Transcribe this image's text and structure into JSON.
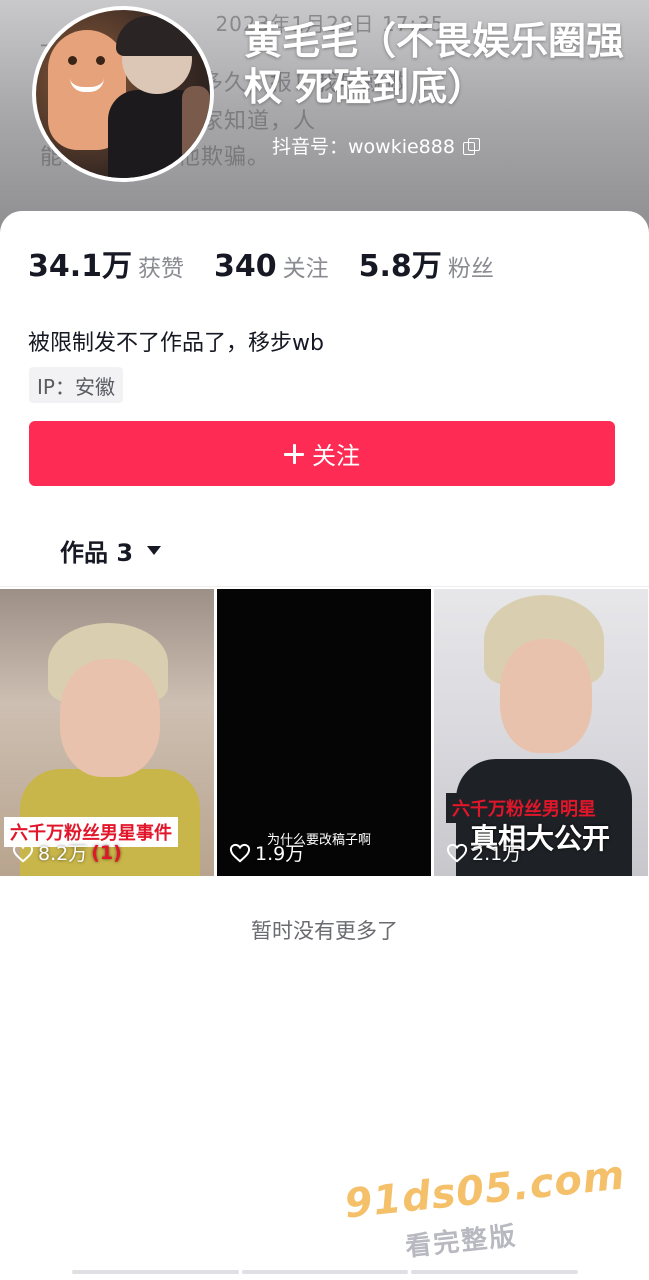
{
  "header": {
    "background_lines": [
      "2023年1月28日 17:35",
      "一直…不…大…",
      "不知道还能发声多久，报！我早就做",
      "得他的…自己…家知道，人",
      "能…多少人被他欺骗。"
    ],
    "name": "黄毛毛（不畏娱乐圈强权 死磕到底）",
    "douyin_id": "抖音号：wowkie888"
  },
  "stats": [
    {
      "value": "34.1万",
      "label": "获赞"
    },
    {
      "value": "340",
      "label": "关注"
    },
    {
      "value": "5.8万",
      "label": "粉丝"
    }
  ],
  "bio": "被限制发不了作品了，移步wb",
  "ip_location": "IP：安徽",
  "follow_button": "关注",
  "works_tab": {
    "label": "作品 3"
  },
  "videos": [
    {
      "overlay": "六千万粉丝男星事件",
      "likes": "8.2万",
      "badge": "(1)"
    },
    {
      "caption": "为什么要改稿子啊",
      "likes": "1.9万"
    },
    {
      "overlay_top": "六千万粉丝男明星",
      "overlay_bottom": "真相大公开",
      "likes": "2.1万"
    }
  ],
  "no_more_text": "暂时没有更多了",
  "watermark": {
    "main": "91ds05.com",
    "sub": "看完整版"
  },
  "colors": {
    "accent": "#fe2c55",
    "overlay_red": "#e2162a"
  }
}
